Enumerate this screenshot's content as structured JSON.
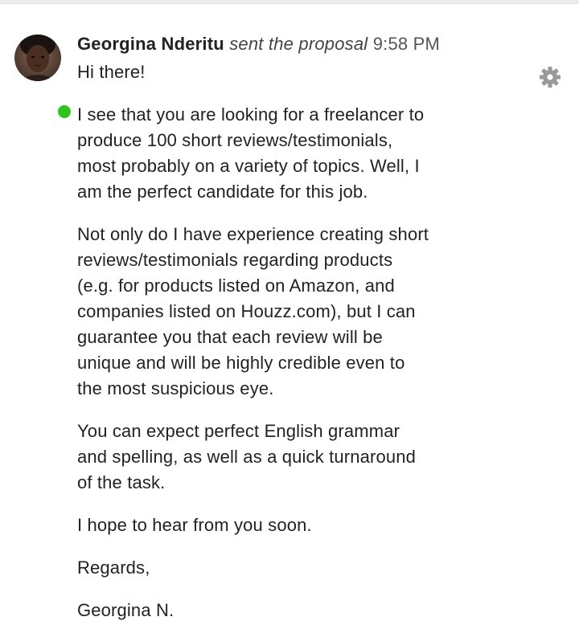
{
  "message": {
    "sender_name": "Georgina Nderitu",
    "action_text": "sent the proposal",
    "time": "9:58 PM",
    "presence_status": "online",
    "paragraphs": [
      "Hi there!",
      "I see that you are looking for a freelancer to\nproduce 100 short reviews/testimonials,\nmost probably on a variety of topics. Well, I\nam the perfect candidate for this job.",
      "Not only do I have experience creating short\nreviews/testimonials regarding products\n(e.g. for products listed on Amazon, and\ncompanies listed on Houzz.com), but I can\nguarantee you that each review will be\nunique and will be highly credible even to\nthe most suspicious eye.",
      "You can expect perfect English grammar\nand spelling, as well as a quick turnaround\nof the task.",
      "I hope to hear from you soon.",
      "Regards,",
      "Georgina N."
    ]
  },
  "icons": {
    "settings": "gear-icon",
    "presence": "online-status-icon"
  },
  "colors": {
    "presence_online": "#2ec41b",
    "gear": "#9a9a9a"
  }
}
